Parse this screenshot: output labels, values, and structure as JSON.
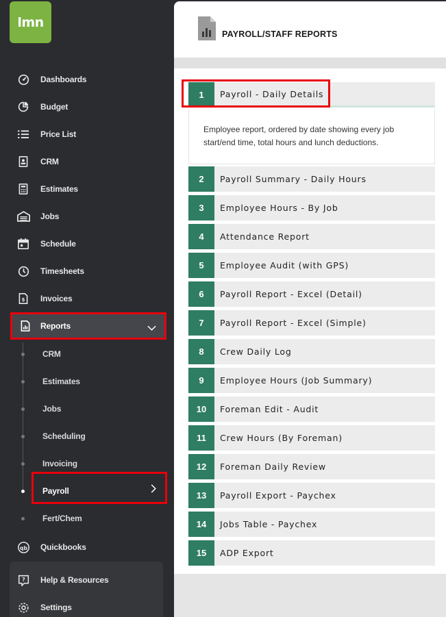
{
  "app": {
    "logo_text": "lmn",
    "brand_color": "#7cb342",
    "accent_color": "#2f7d62",
    "highlight_color": "#e8000b"
  },
  "sidebar": {
    "items": [
      {
        "label": "Dashboards",
        "icon": "gauge-icon"
      },
      {
        "label": "Budget",
        "icon": "pie-chart-icon"
      },
      {
        "label": "Price List",
        "icon": "list-icon"
      },
      {
        "label": "CRM",
        "icon": "contact-card-icon"
      },
      {
        "label": "Estimates",
        "icon": "calculator-icon"
      },
      {
        "label": "Jobs",
        "icon": "garage-icon"
      },
      {
        "label": "Schedule",
        "icon": "calendar-icon"
      },
      {
        "label": "Timesheets",
        "icon": "clock-icon"
      },
      {
        "label": "Invoices",
        "icon": "invoice-icon"
      },
      {
        "label": "Reports",
        "icon": "report-icon"
      }
    ],
    "report_subitems": [
      {
        "label": "CRM"
      },
      {
        "label": "Estimates"
      },
      {
        "label": "Jobs"
      },
      {
        "label": "Scheduling"
      },
      {
        "label": "Invoicing"
      },
      {
        "label": "Payroll"
      },
      {
        "label": "Fert/Chem"
      }
    ],
    "quickbooks_label": "Quickbooks",
    "help_label": "Help & Resources",
    "settings_label": "Settings"
  },
  "main": {
    "title": "PAYROLL/STAFF REPORTS",
    "expanded_description": "Employee report, ordered by date showing every job start/end time, total hours and lunch deductions.",
    "reports": [
      {
        "num": "1",
        "label": "Payroll - Daily Details"
      },
      {
        "num": "2",
        "label": "Payroll Summary - Daily Hours"
      },
      {
        "num": "3",
        "label": "Employee Hours - By Job"
      },
      {
        "num": "4",
        "label": "Attendance Report"
      },
      {
        "num": "5",
        "label": "Employee Audit (with GPS)"
      },
      {
        "num": "6",
        "label": "Payroll Report - Excel (Detail)"
      },
      {
        "num": "7",
        "label": "Payroll Report - Excel (Simple)"
      },
      {
        "num": "8",
        "label": "Crew Daily Log"
      },
      {
        "num": "9",
        "label": "Employee Hours (Job Summary)"
      },
      {
        "num": "10",
        "label": "Foreman Edit - Audit"
      },
      {
        "num": "11",
        "label": "Crew Hours (By Foreman)"
      },
      {
        "num": "12",
        "label": "Foreman Daily Review"
      },
      {
        "num": "13",
        "label": "Payroll Export - Paychex"
      },
      {
        "num": "14",
        "label": "Jobs Table - Paychex"
      },
      {
        "num": "15",
        "label": "ADP Export"
      }
    ]
  }
}
